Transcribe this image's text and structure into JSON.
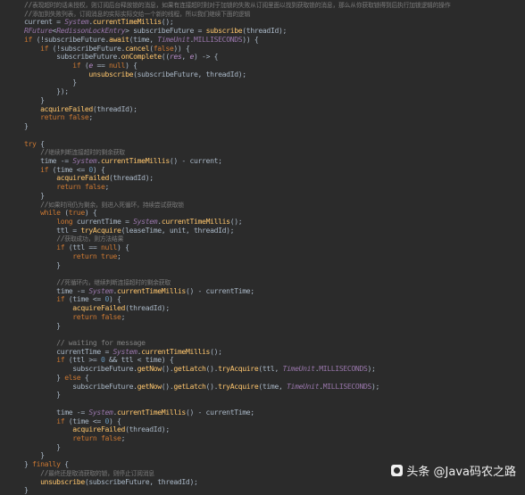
{
  "editor": {
    "theme_colors": {
      "background": "#2b2b2b",
      "plain": "#a9b7c6",
      "keyword": "#cc7832",
      "method": "#ffc66d",
      "number": "#6897bb",
      "static": "#9876aa",
      "comment": "#808080"
    },
    "lines": [
      [
        [
          "t-comment",
          "//"
        ],
        [
          "t-cn",
          "表现超时的话未授权，则订阅后台释放锁的消息，如果有连接超时则对于加锁的失败从订阅里面以找到获取锁的消息，那么从你获取锁得到后执行加锁逻辑的操作"
        ]
      ],
      [
        [
          "t-comment",
          "//"
        ],
        [
          "t-cn",
          "添加到失败列表，订阅消息的实际实际交给一个新的线程，所以我们继续下面的逻辑"
        ]
      ],
      [
        [
          "t-plain",
          "current = "
        ],
        [
          "t-cls",
          "System"
        ],
        [
          "t-plain",
          "."
        ],
        [
          "t-fn",
          "currentTimeMillis"
        ],
        [
          "t-plain",
          "();"
        ]
      ],
      [
        [
          "t-cls",
          "RFuture"
        ],
        [
          "t-plain",
          "<"
        ],
        [
          "t-cls",
          "RedissonLockEntry"
        ],
        [
          "t-plain",
          "> subscribeFuture = "
        ],
        [
          "t-fn",
          "subscribe"
        ],
        [
          "t-plain",
          "(threadId);"
        ]
      ],
      [
        [
          "t-kw",
          "if "
        ],
        [
          "t-plain",
          "(!subscribeFuture."
        ],
        [
          "t-fn",
          "await"
        ],
        [
          "t-plain",
          "(time, "
        ],
        [
          "t-cls",
          "TimeUnit"
        ],
        [
          "t-plain",
          "."
        ],
        [
          "t-const",
          "MILLISECONDS"
        ],
        [
          "t-plain",
          ")) {"
        ]
      ],
      [
        [
          "t-plain",
          "    "
        ],
        [
          "t-kw",
          "if "
        ],
        [
          "t-plain",
          "(!subscribeFuture."
        ],
        [
          "t-fn",
          "cancel"
        ],
        [
          "t-plain",
          "("
        ],
        [
          "t-kw",
          "false"
        ],
        [
          "t-plain",
          ")) {"
        ]
      ],
      [
        [
          "t-plain",
          "        subscribeFuture."
        ],
        [
          "t-fn",
          "onComplete"
        ],
        [
          "t-plain",
          "(("
        ],
        [
          "t-param",
          "res"
        ],
        [
          "t-plain",
          ", "
        ],
        [
          "t-param",
          "e"
        ],
        [
          "t-plain",
          ") -> {"
        ]
      ],
      [
        [
          "t-plain",
          "            "
        ],
        [
          "t-kw",
          "if "
        ],
        [
          "t-plain",
          "("
        ],
        [
          "t-param",
          "e"
        ],
        [
          "t-plain",
          " == "
        ],
        [
          "t-kw",
          "null"
        ],
        [
          "t-plain",
          ") {"
        ]
      ],
      [
        [
          "t-plain",
          "                "
        ],
        [
          "t-fn",
          "unsubscribe"
        ],
        [
          "t-plain",
          "(subscribeFuture, threadId);"
        ]
      ],
      [
        [
          "t-plain",
          "            }"
        ]
      ],
      [
        [
          "t-plain",
          "        });"
        ]
      ],
      [
        [
          "t-plain",
          "    }"
        ]
      ],
      [
        [
          "t-plain",
          "    "
        ],
        [
          "t-fn",
          "acquireFailed"
        ],
        [
          "t-plain",
          "(threadId);"
        ]
      ],
      [
        [
          "t-plain",
          "    "
        ],
        [
          "t-kw",
          "return false"
        ],
        [
          "t-plain",
          ";"
        ]
      ],
      [
        [
          "t-plain",
          "}"
        ]
      ],
      [
        [
          "t-plain",
          ""
        ]
      ],
      [
        [
          "t-kw",
          "try "
        ],
        [
          "t-plain",
          "{"
        ]
      ],
      [
        [
          "t-plain",
          "    "
        ],
        [
          "t-comment",
          "//"
        ],
        [
          "t-cn",
          "继续判断连接超时的剩余获取"
        ]
      ],
      [
        [
          "t-plain",
          "    time -= "
        ],
        [
          "t-cls",
          "System"
        ],
        [
          "t-plain",
          "."
        ],
        [
          "t-fn",
          "currentTimeMillis"
        ],
        [
          "t-plain",
          "() - current;"
        ]
      ],
      [
        [
          "t-plain",
          "    "
        ],
        [
          "t-kw",
          "if "
        ],
        [
          "t-plain",
          "(time <= "
        ],
        [
          "t-num",
          "0"
        ],
        [
          "t-plain",
          ") {"
        ]
      ],
      [
        [
          "t-plain",
          "        "
        ],
        [
          "t-fn",
          "acquireFailed"
        ],
        [
          "t-plain",
          "(threadId);"
        ]
      ],
      [
        [
          "t-plain",
          "        "
        ],
        [
          "t-kw",
          "return false"
        ],
        [
          "t-plain",
          ";"
        ]
      ],
      [
        [
          "t-plain",
          "    }"
        ]
      ],
      [
        [
          "t-plain",
          "    "
        ],
        [
          "t-comment",
          "//"
        ],
        [
          "t-cn",
          "如果时间仍为剩余，则进入死循环，持续尝试获取锁"
        ]
      ],
      [
        [
          "t-plain",
          "    "
        ],
        [
          "t-kw",
          "while "
        ],
        [
          "t-plain",
          "("
        ],
        [
          "t-kw",
          "true"
        ],
        [
          "t-plain",
          ") {"
        ]
      ],
      [
        [
          "t-plain",
          "        "
        ],
        [
          "t-kw",
          "long "
        ],
        [
          "t-plain",
          "currentTime = "
        ],
        [
          "t-cls",
          "System"
        ],
        [
          "t-plain",
          "."
        ],
        [
          "t-fn",
          "currentTimeMillis"
        ],
        [
          "t-plain",
          "();"
        ]
      ],
      [
        [
          "t-plain",
          "        ttl = "
        ],
        [
          "t-fn",
          "tryAcquire"
        ],
        [
          "t-plain",
          "(leaseTime, unit, threadId);"
        ]
      ],
      [
        [
          "t-plain",
          "        "
        ],
        [
          "t-comment",
          "//"
        ],
        [
          "t-cn",
          "获取成功，则方法结果"
        ]
      ],
      [
        [
          "t-plain",
          "        "
        ],
        [
          "t-kw",
          "if "
        ],
        [
          "t-plain",
          "(ttl == "
        ],
        [
          "t-kw",
          "null"
        ],
        [
          "t-plain",
          ") {"
        ]
      ],
      [
        [
          "t-plain",
          "            "
        ],
        [
          "t-kw",
          "return true"
        ],
        [
          "t-plain",
          ";"
        ]
      ],
      [
        [
          "t-plain",
          "        }"
        ]
      ],
      [
        [
          "t-plain",
          ""
        ]
      ],
      [
        [
          "t-plain",
          "        "
        ],
        [
          "t-comment",
          "//"
        ],
        [
          "t-cn",
          "死循环内，继续判断连接超时的剩余获取"
        ]
      ],
      [
        [
          "t-plain",
          "        time -= "
        ],
        [
          "t-cls",
          "System"
        ],
        [
          "t-plain",
          "."
        ],
        [
          "t-fn",
          "currentTimeMillis"
        ],
        [
          "t-plain",
          "() - currentTime;"
        ]
      ],
      [
        [
          "t-plain",
          "        "
        ],
        [
          "t-kw",
          "if "
        ],
        [
          "t-plain",
          "(time <= "
        ],
        [
          "t-num",
          "0"
        ],
        [
          "t-plain",
          ") {"
        ]
      ],
      [
        [
          "t-plain",
          "            "
        ],
        [
          "t-fn",
          "acquireFailed"
        ],
        [
          "t-plain",
          "(threadId);"
        ]
      ],
      [
        [
          "t-plain",
          "            "
        ],
        [
          "t-kw",
          "return false"
        ],
        [
          "t-plain",
          ";"
        ]
      ],
      [
        [
          "t-plain",
          "        }"
        ]
      ],
      [
        [
          "t-plain",
          ""
        ]
      ],
      [
        [
          "t-plain",
          "        "
        ],
        [
          "t-comment",
          "// waiting for message"
        ]
      ],
      [
        [
          "t-plain",
          "        currentTime = "
        ],
        [
          "t-cls",
          "System"
        ],
        [
          "t-plain",
          "."
        ],
        [
          "t-fn",
          "currentTimeMillis"
        ],
        [
          "t-plain",
          "();"
        ]
      ],
      [
        [
          "t-plain",
          "        "
        ],
        [
          "t-kw",
          "if "
        ],
        [
          "t-plain",
          "(ttl >= "
        ],
        [
          "t-num",
          "0 "
        ],
        [
          "t-plain",
          "&& ttl < time) {"
        ]
      ],
      [
        [
          "t-plain",
          "            subscribeFuture."
        ],
        [
          "t-fn",
          "getNow"
        ],
        [
          "t-plain",
          "()."
        ],
        [
          "t-fn",
          "getLatch"
        ],
        [
          "t-plain",
          "()."
        ],
        [
          "t-fn",
          "tryAcquire"
        ],
        [
          "t-plain",
          "(ttl, "
        ],
        [
          "t-cls",
          "TimeUnit"
        ],
        [
          "t-plain",
          "."
        ],
        [
          "t-const",
          "MILLISECONDS"
        ],
        [
          "t-plain",
          ");"
        ]
      ],
      [
        [
          "t-plain",
          "        } "
        ],
        [
          "t-kw",
          "else "
        ],
        [
          "t-plain",
          "{"
        ]
      ],
      [
        [
          "t-plain",
          "            subscribeFuture."
        ],
        [
          "t-fn",
          "getNow"
        ],
        [
          "t-plain",
          "()."
        ],
        [
          "t-fn",
          "getLatch"
        ],
        [
          "t-plain",
          "()."
        ],
        [
          "t-fn",
          "tryAcquire"
        ],
        [
          "t-plain",
          "(time, "
        ],
        [
          "t-cls",
          "TimeUnit"
        ],
        [
          "t-plain",
          "."
        ],
        [
          "t-const",
          "MILLISECONDS"
        ],
        [
          "t-plain",
          ");"
        ]
      ],
      [
        [
          "t-plain",
          "        }"
        ]
      ],
      [
        [
          "t-plain",
          ""
        ]
      ],
      [
        [
          "t-plain",
          "        time -= "
        ],
        [
          "t-cls",
          "System"
        ],
        [
          "t-plain",
          "."
        ],
        [
          "t-fn",
          "currentTimeMillis"
        ],
        [
          "t-plain",
          "() - currentTime;"
        ]
      ],
      [
        [
          "t-plain",
          "        "
        ],
        [
          "t-kw",
          "if "
        ],
        [
          "t-plain",
          "(time <= "
        ],
        [
          "t-num",
          "0"
        ],
        [
          "t-plain",
          ") {"
        ]
      ],
      [
        [
          "t-plain",
          "            "
        ],
        [
          "t-fn",
          "acquireFailed"
        ],
        [
          "t-plain",
          "(threadId);"
        ]
      ],
      [
        [
          "t-plain",
          "            "
        ],
        [
          "t-kw",
          "return false"
        ],
        [
          "t-plain",
          ";"
        ]
      ],
      [
        [
          "t-plain",
          "        }"
        ]
      ],
      [
        [
          "t-plain",
          "    }"
        ]
      ],
      [
        [
          "t-plain",
          "} "
        ],
        [
          "t-kw",
          "finally "
        ],
        [
          "t-plain",
          "{"
        ]
      ],
      [
        [
          "t-plain",
          "    "
        ],
        [
          "t-comment",
          "//"
        ],
        [
          "t-cn",
          "最终还是取消获取的锁，则停止订阅消息"
        ]
      ],
      [
        [
          "t-plain",
          "    "
        ],
        [
          "t-fn",
          "unsubscribe"
        ],
        [
          "t-plain",
          "(subscribeFuture, threadId);"
        ]
      ],
      [
        [
          "t-plain",
          "}"
        ]
      ]
    ]
  },
  "watermark": {
    "text": "头条 @Java码农之路",
    "icon": "toutiao-logo-icon"
  }
}
